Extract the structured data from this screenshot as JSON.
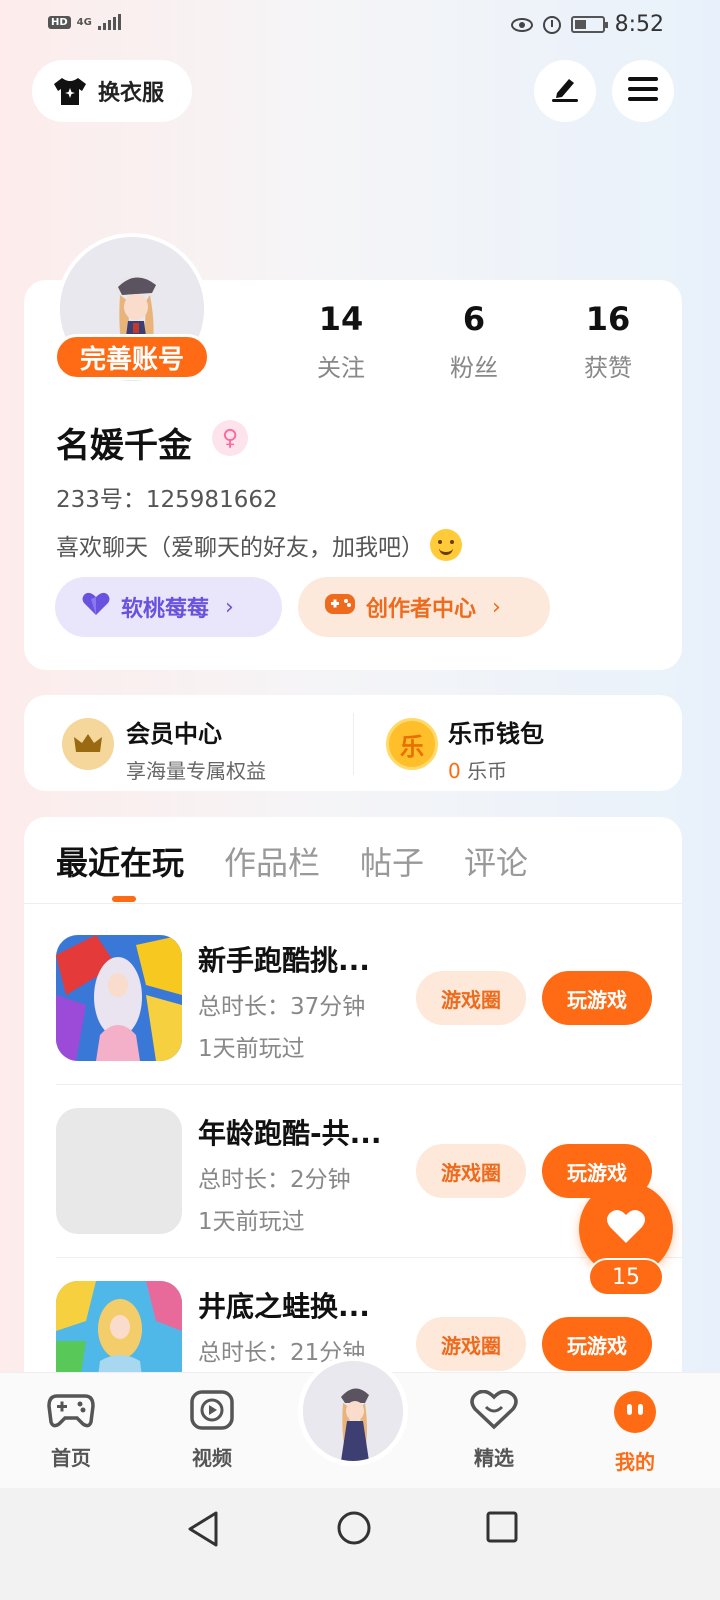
{
  "status_bar": {
    "hd": "HD",
    "network": "4G",
    "time": "8:52"
  },
  "top": {
    "outfit_label": "换衣服"
  },
  "profile": {
    "complete_badge": "完善账号",
    "stats": [
      {
        "num": "14",
        "label": "关注"
      },
      {
        "num": "6",
        "label": "粉丝"
      },
      {
        "num": "16",
        "label": "获赞"
      }
    ],
    "username": "名媛千金",
    "uid": "233号：125981662",
    "bio": "喜欢聊天（爱聊天的好友，加我吧）",
    "pill_left": "软桃莓莓",
    "pill_right": "创作者中心"
  },
  "vip": {
    "member_title": "会员中心",
    "member_sub": "享海量专属权益",
    "wallet_title": "乐币钱包",
    "wallet_icon_text": "乐",
    "wallet_amount": "0",
    "wallet_unit": " 乐币"
  },
  "tabs": [
    "最近在玩",
    "作品栏",
    "帖子",
    "评论"
  ],
  "games": [
    {
      "title": "新手跑酷挑...",
      "duration": "总时长：37分钟",
      "last": "1天前玩过",
      "circle_btn": "游戏圈",
      "play_btn": "玩游戏"
    },
    {
      "title": "年龄跑酷-共...",
      "duration": "总时长：2分钟",
      "last": "1天前玩过",
      "circle_btn": "游戏圈",
      "play_btn": "玩游戏"
    },
    {
      "title": "井底之蛙换...",
      "duration": "总时长：21分钟",
      "last": "",
      "circle_btn": "游戏圈",
      "play_btn": "玩游戏"
    }
  ],
  "float_like": {
    "count": "15"
  },
  "nav": {
    "home": "首页",
    "video": "视频",
    "featured": "精选",
    "mine": "我的"
  },
  "colors": {
    "accent": "#ff6b14",
    "purple": "#6a52e0"
  }
}
